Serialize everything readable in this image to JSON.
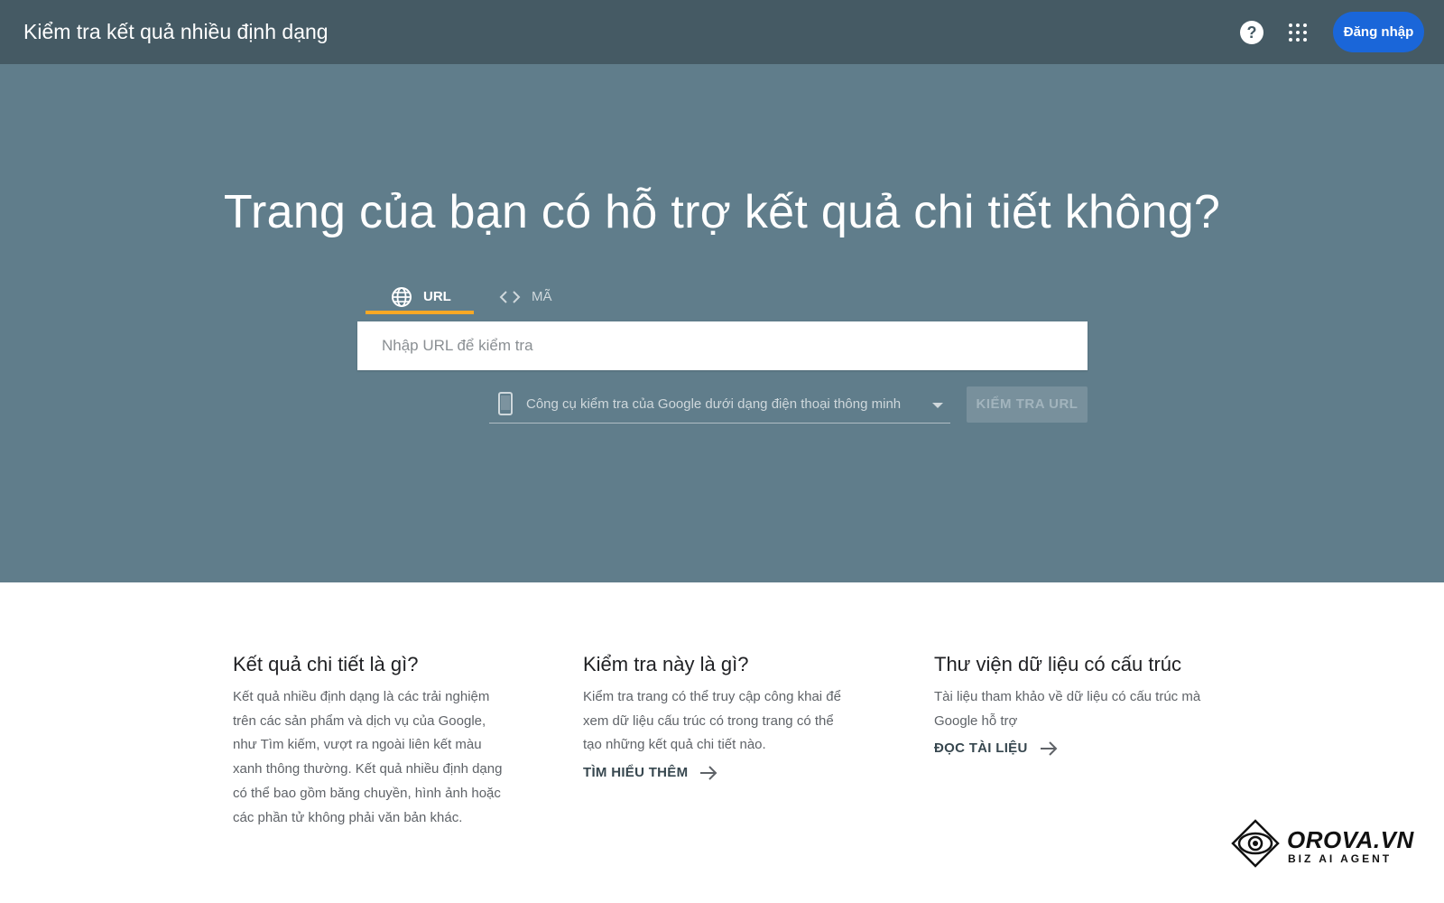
{
  "header": {
    "title": "Kiểm tra kết quả nhiều định dạng",
    "help_icon": "help-circle-icon",
    "apps_icon": "apps-grid-icon",
    "signin_label": "Đăng nhập"
  },
  "hero": {
    "title": "Trang của bạn có hỗ trợ kết quả chi tiết không?",
    "tabs": [
      {
        "label": "URL",
        "icon": "globe-icon",
        "selected": true
      },
      {
        "label": "MÃ",
        "icon": "code-icon",
        "selected": false
      }
    ],
    "url_input": {
      "placeholder": "Nhập URL để kiểm tra",
      "value": ""
    },
    "device_select": {
      "icon": "smartphone-icon",
      "selected": "Công cụ kiểm tra của Google dưới dạng điện thoại thông minh"
    },
    "check_button_label": "KIỂM TRA URL"
  },
  "info": [
    {
      "title": "Kết quả chi tiết là gì?",
      "lines": [
        "Kết quả nhiều định dạng là các trải nghiệm",
        "trên các sản phẩm và dịch vụ của Google,",
        "như Tìm kiếm, vượt ra ngoài liên kết màu",
        "xanh thông thường. Kết quả nhiều định dạng",
        "có thể bao gồm băng chuyền, hình ảnh hoặc",
        "các phần tử không phải văn bản khác."
      ]
    },
    {
      "title": "Kiểm tra này là gì?",
      "lines": [
        "Kiểm tra trang có thể truy cập công khai để",
        "xem dữ liệu cấu trúc có trong trang có thể",
        "tạo những kết quả chi tiết nào."
      ],
      "link": "TÌM HIỂU THÊM"
    },
    {
      "title": "Thư viện dữ liệu có cấu trúc",
      "lines": [
        "Tài liệu tham khảo về dữ liệu có cấu trúc mà",
        "Google hỗ trợ"
      ],
      "link": "ĐỌC TÀI LIỆU"
    }
  ],
  "brand": {
    "name": "OROVA.VN",
    "tagline": "BIZ AI AGENT"
  },
  "colors": {
    "topbar": "#455a64",
    "hero": "#607d8b",
    "accent_tab": "#f9a825",
    "signin": "#1a66d9"
  }
}
